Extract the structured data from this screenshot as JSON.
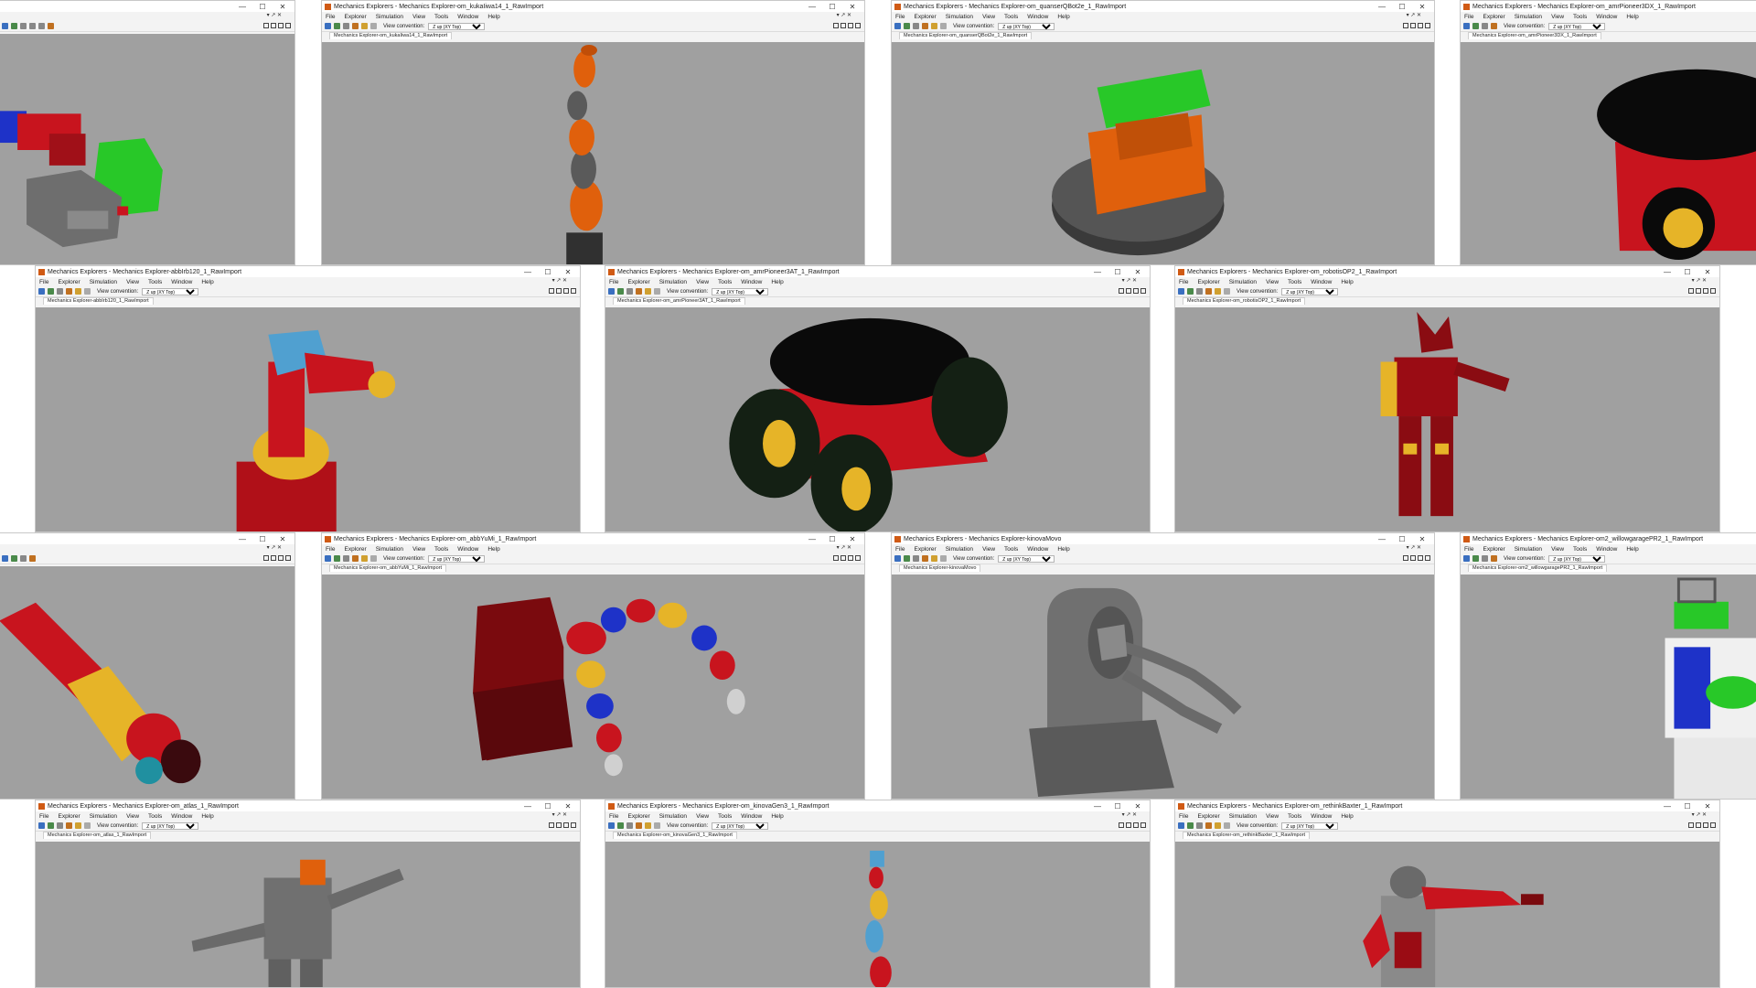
{
  "app": {
    "name": "Mechanics Explorers"
  },
  "menus": [
    "File",
    "Explorer",
    "Simulation",
    "View",
    "Tools",
    "Window",
    "Help"
  ],
  "toolbar": {
    "view_convention_label": "View convention:",
    "view_convention_value": "Z up (XY Top)"
  },
  "window_controls": {
    "minimize": "—",
    "maximize": "☐",
    "close": "✕"
  },
  "colors": {
    "canvas": "#a0a0a0",
    "red": "#c8141e",
    "dark_red": "#7a0a0e",
    "orange": "#e0600c",
    "yellow": "#e6b428",
    "blue": "#1e32c8",
    "green": "#28c828",
    "gray": "#707070",
    "black": "#0a0a0a",
    "cyan": "#50a0d0"
  },
  "windows": [
    {
      "title": "",
      "tab": "",
      "model": "robotic-gripper"
    },
    {
      "title": "Mechanics Explorers - Mechanics Explorer-om_kukaIiwa14_1_RawImport",
      "tab": "Mechanics Explorer-om_kukaIiwa14_1_RawImport",
      "model": "kuka-iiwa-arm"
    },
    {
      "title": "Mechanics Explorers - Mechanics Explorer-om_quanserQBot2e_1_RawImport",
      "tab": "Mechanics Explorer-om_quanserQBot2e_1_RawImport",
      "model": "qbot-mobile-base"
    },
    {
      "title": "Mechanics Explorers - Mechanics Explorer-om_amrPioneer3DX_1_RawImport",
      "tab": "Mechanics Explorer-om_amrPioneer3DX_1_RawImport",
      "model": "pioneer-3dx"
    },
    {
      "title": "Mechanics Explorers - Mechanics Explorer-abbIrb120_1_RawImport",
      "tab": "Mechanics Explorer-abbIrb120_1_RawImport",
      "model": "abb-irb120"
    },
    {
      "title": "Mechanics Explorers - Mechanics Explorer-om_amrPioneer3AT_1_RawImport",
      "tab": "Mechanics Explorer-om_amrPioneer3AT_1_RawImport",
      "model": "pioneer-3at"
    },
    {
      "title": "Mechanics Explorers - Mechanics Explorer-om_robotisOP2_1_RawImport",
      "tab": "Mechanics Explorer-om_robotisOP2_1_RawImport",
      "model": "robotis-op2"
    },
    {
      "title": "",
      "tab": "",
      "model": "industrial-arm"
    },
    {
      "title": "Mechanics Explorers - Mechanics Explorer-om_abbYuMi_1_RawImport",
      "tab": "Mechanics Explorer-om_abbYuMi_1_RawImport",
      "model": "abb-yumi"
    },
    {
      "title": "Mechanics Explorers - Mechanics Explorer-kinovaMovo",
      "tab": "Mechanics Explorer-kinovaMovo",
      "model": "kinova-movo"
    },
    {
      "title": "Mechanics Explorers - Mechanics Explorer-om2_willowgaragePR2_1_RawImport",
      "tab": "Mechanics Explorer-om2_willowgaragePR2_1_RawImport",
      "model": "willow-pr2"
    },
    {
      "title": "Mechanics Explorers - Mechanics Explorer-om_atlas_1_RawImport",
      "tab": "Mechanics Explorer-om_atlas_1_RawImport",
      "model": "atlas"
    },
    {
      "title": "Mechanics Explorers - Mechanics Explorer-om_kinovaGen3_1_RawImport",
      "tab": "Mechanics Explorer-om_kinovaGen3_1_RawImport",
      "model": "kinova-gen3"
    },
    {
      "title": "Mechanics Explorers - Mechanics Explorer-om_rethinkBaxter_1_RawImport",
      "tab": "Mechanics Explorer-om_rethinkBaxter_1_RawImport",
      "model": "rethink-baxter"
    }
  ]
}
